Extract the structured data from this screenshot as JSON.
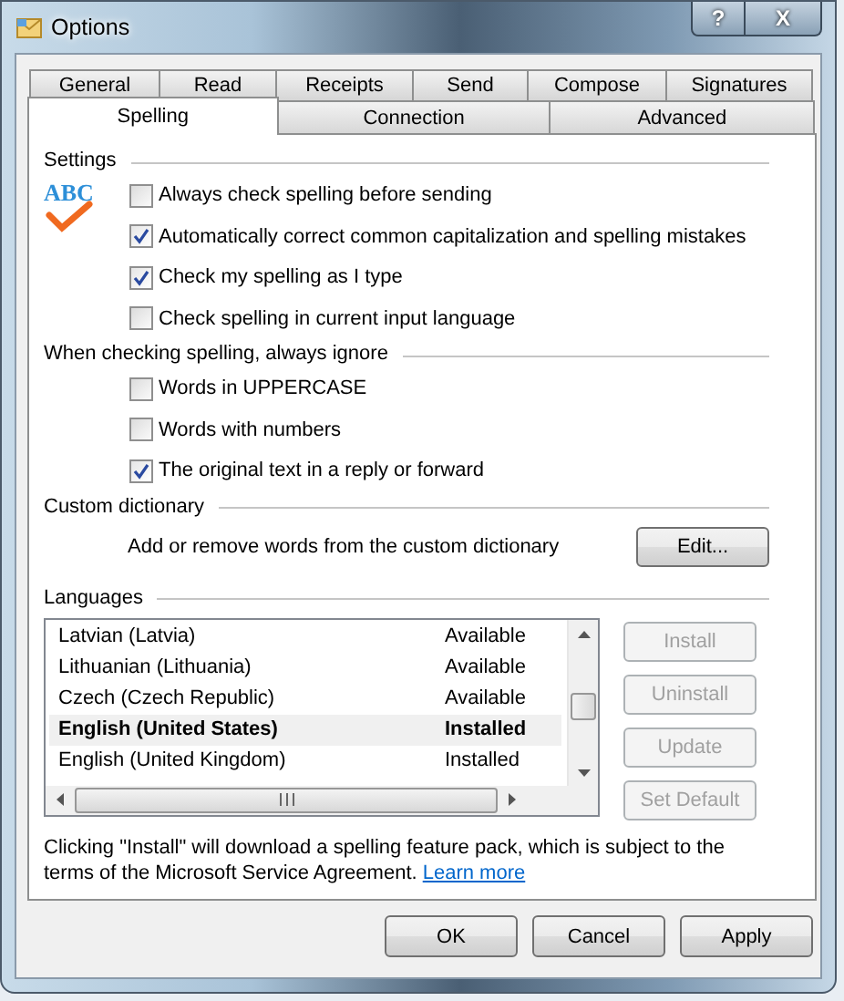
{
  "window": {
    "title": "Options",
    "controls": [
      "?",
      "X"
    ]
  },
  "tab_rows": [
    {
      "tabs": [
        {
          "label": "General",
          "selected": false
        },
        {
          "label": "Read",
          "selected": false
        },
        {
          "label": "Receipts",
          "selected": false
        },
        {
          "label": "Send",
          "selected": false
        },
        {
          "label": "Compose",
          "selected": false
        },
        {
          "label": "Signatures",
          "selected": false
        }
      ]
    },
    {
      "tabs": [
        {
          "label": "Spelling",
          "selected": true
        },
        {
          "label": "Connection",
          "selected": false
        },
        {
          "label": "Advanced",
          "selected": false
        }
      ]
    }
  ],
  "settings": {
    "heading": "Settings",
    "icon_text": "ABC",
    "options": [
      {
        "label": "Always check spelling before sending",
        "checked": false
      },
      {
        "label": "Automatically correct common capitalization and spelling mistakes",
        "checked": true
      },
      {
        "label": "Check my spelling as I type",
        "checked": true
      },
      {
        "label": "Check spelling in current input language",
        "checked": false
      }
    ]
  },
  "ignore": {
    "heading": "When checking spelling, always ignore",
    "options": [
      {
        "label": "Words in UPPERCASE",
        "checked": false
      },
      {
        "label": "Words with numbers",
        "checked": false
      },
      {
        "label": "The original text in a reply or forward",
        "checked": true
      }
    ]
  },
  "custom_dictionary": {
    "heading": "Custom dictionary",
    "description": "Add or remove words from the custom dictionary",
    "button": "Edit..."
  },
  "languages": {
    "heading": "Languages",
    "rows": [
      {
        "name": "Latvian (Latvia)",
        "status": "Available",
        "selected": false
      },
      {
        "name": "Lithuanian (Lithuania)",
        "status": "Available",
        "selected": false
      },
      {
        "name": "Czech (Czech Republic)",
        "status": "Available",
        "selected": false
      },
      {
        "name": "English (United States)",
        "status": "Installed",
        "selected": true
      },
      {
        "name": "English (United Kingdom)",
        "status": "Installed",
        "selected": false
      }
    ],
    "buttons": [
      {
        "label": "Install",
        "disabled": true
      },
      {
        "label": "Uninstall",
        "disabled": true
      },
      {
        "label": "Update",
        "disabled": true
      },
      {
        "label": "Set Default",
        "disabled": true
      }
    ]
  },
  "notice": {
    "text": "Clicking \"Install\" will download a spelling feature pack, which is subject to the terms of the Microsoft Service Agreement.",
    "link": "Learn more"
  },
  "buttons": [
    "OK",
    "Cancel",
    "Apply"
  ]
}
